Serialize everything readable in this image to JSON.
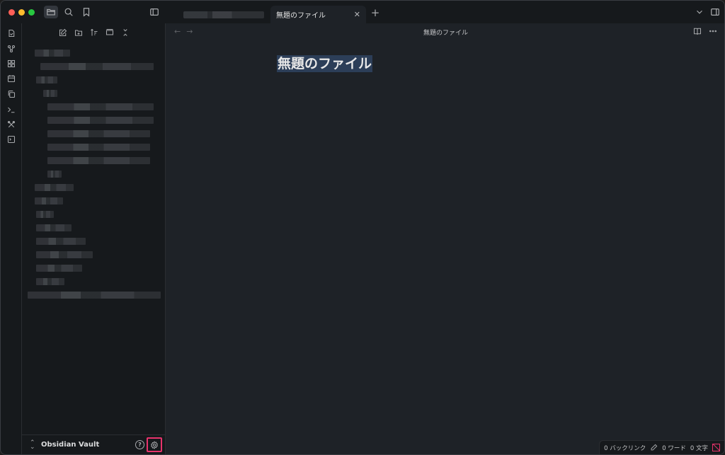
{
  "window": {
    "tabs": [
      {
        "label": "",
        "active": false
      },
      {
        "label": "無題のファイル",
        "active": true
      }
    ],
    "close_glyph": "✕",
    "new_tab_glyph": "+"
  },
  "ribbon": {
    "icons": [
      "quick-switcher-icon",
      "graph-view-icon",
      "canvas-icon",
      "daily-notes-icon",
      "templates-icon",
      "command-palette-icon",
      "tools-icon",
      "terminal-icon"
    ]
  },
  "sidebar": {
    "toolbar": [
      "new-note-icon",
      "new-folder-icon",
      "sort-icon",
      "collapse-icon",
      "close-all-icon"
    ],
    "vault": {
      "name": "Obsidian Vault",
      "chevron": "⌃⌄"
    },
    "help_glyph": "?"
  },
  "main": {
    "view_title": "無題のファイル",
    "nav_back": "←",
    "nav_forward": "→",
    "doc_title": "無題のファイル"
  },
  "statusbar": {
    "backlinks": "0 バックリンク",
    "words": "0 ワード",
    "chars": "0 文字"
  },
  "colors": {
    "accent_highlight": "#e8336c",
    "title_selection": "#2c3e58"
  }
}
